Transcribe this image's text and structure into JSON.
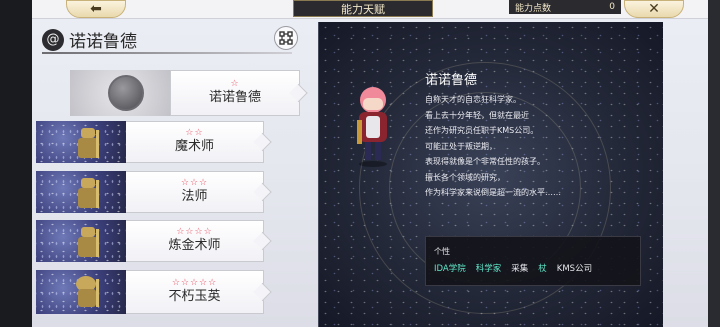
{
  "header": {
    "title": "能力天赋",
    "points_label": "能力点数",
    "points_value": "0"
  },
  "character": {
    "name": "诺诺鲁德"
  },
  "classes": [
    {
      "name": "诺诺鲁德",
      "stars": "☆"
    },
    {
      "name": "魔术师",
      "stars": "☆☆"
    },
    {
      "name": "法师",
      "stars": "☆☆☆"
    },
    {
      "name": "炼金术师",
      "stars": "☆☆☆☆"
    },
    {
      "name": "不朽玉英",
      "stars": "☆☆☆☆☆"
    }
  ],
  "detail": {
    "name": "诺诺鲁德",
    "description": [
      "自称天才的自恋狂科学家。",
      "看上去十分年轻，但就在最近",
      "还作为研究员任职于KMS公司。",
      "可能正处于叛逆期，",
      "表现得就像是个非常任性的孩子。",
      "擅长各个领域的研究，",
      "作为科学家来说倒是超一流的水平……"
    ],
    "traits_title": "个性",
    "traits": [
      {
        "text": "IDA学院",
        "color": "#5fe6c8"
      },
      {
        "text": "科学家",
        "color": "#5fe6c8"
      },
      {
        "text": "采集",
        "color": "#e8e8ee"
      },
      {
        "text": "杖",
        "color": "#5fe6c8"
      },
      {
        "text": "KMS公司",
        "color": "#e8e8ee"
      }
    ]
  },
  "colors": {
    "star": "#e64a5c",
    "trait_highlight": "#5fe6c8"
  }
}
